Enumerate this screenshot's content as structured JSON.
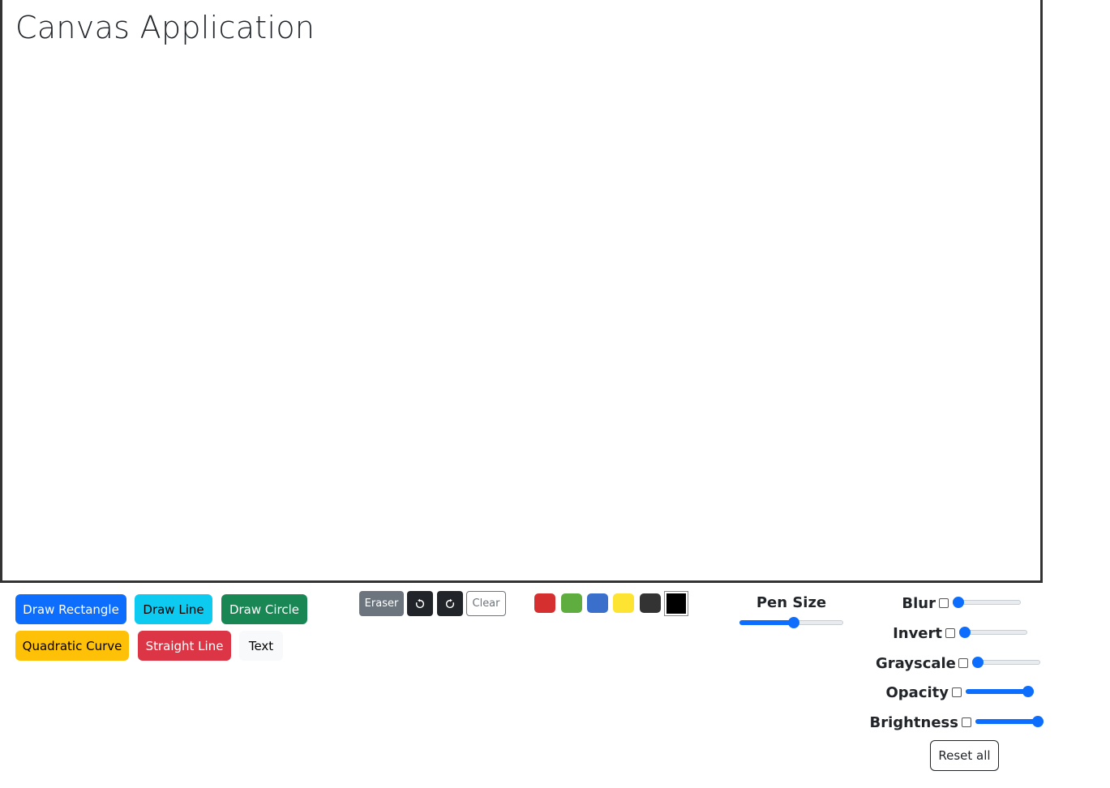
{
  "canvas": {
    "title": "Canvas Application"
  },
  "tools": {
    "draw_rectangle": "Draw Rectangle",
    "draw_line": "Draw Line",
    "draw_circle": "Draw Circle",
    "quadratic_curve": "Quadratic Curve",
    "straight_line": "Straight Line",
    "text": "Text"
  },
  "actions": {
    "eraser": "Eraser",
    "undo_icon": "undo-icon",
    "redo_icon": "redo-icon",
    "clear": "Clear"
  },
  "palette": {
    "colors": [
      "#d62f2f",
      "#5fac3f",
      "#3a6fcc",
      "#fde332",
      "#333333"
    ],
    "selected_color": "#000000"
  },
  "pen": {
    "label": "Pen Size",
    "value_fraction": 0.52
  },
  "filters": {
    "blur": {
      "label": "Blur",
      "enabled": false,
      "value_fraction": 0.0
    },
    "invert": {
      "label": "Invert",
      "enabled": false,
      "value_fraction": 0.0
    },
    "grayscale": {
      "label": "Grayscale",
      "enabled": false,
      "value_fraction": 0.0
    },
    "opacity": {
      "label": "Opacity",
      "enabled": false,
      "value_fraction": 1.0
    },
    "brightness": {
      "label": "Brightness",
      "enabled": false,
      "value_fraction": 1.0
    },
    "reset_label": "Reset all"
  }
}
